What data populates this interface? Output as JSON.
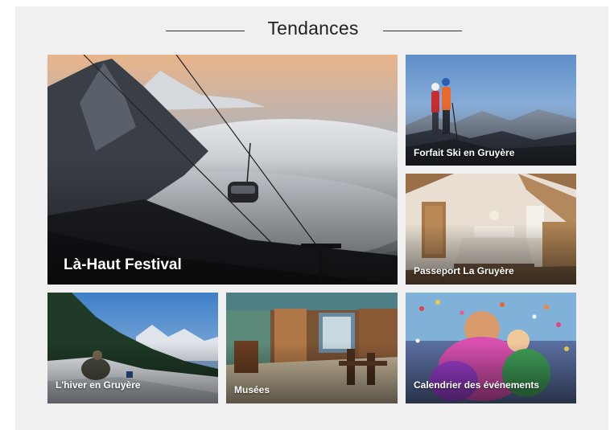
{
  "section": {
    "title": "Tendances"
  },
  "tiles": [
    {
      "id": "festival",
      "label": "Là-Haut Festival"
    },
    {
      "id": "ski",
      "label": "Forfait Ski en Gruyère"
    },
    {
      "id": "passeport",
      "label": "Passeport La Gruyère"
    },
    {
      "id": "hiver",
      "label": "L'hiver en Gruyère"
    },
    {
      "id": "musees",
      "label": "Musées"
    },
    {
      "id": "calendrier",
      "label": "Calendrier des événements"
    }
  ]
}
